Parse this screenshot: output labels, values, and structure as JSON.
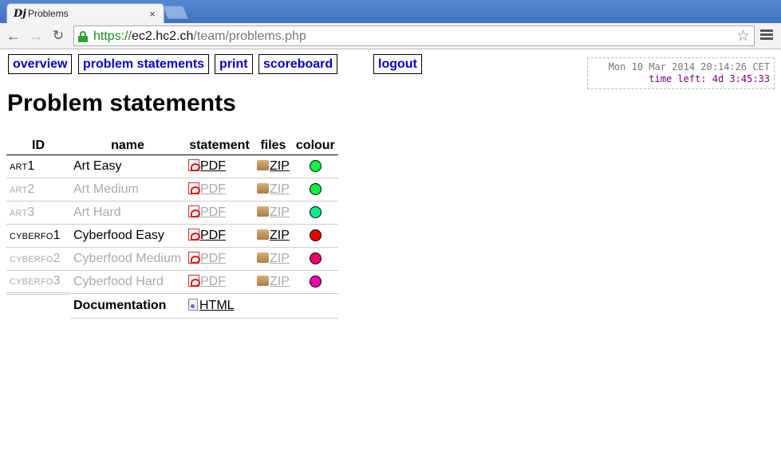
{
  "browser": {
    "tab_title": "Problems",
    "tab_favicon": "Dj",
    "tab_close": "×",
    "url_scheme": "https://",
    "url_host": "ec2.hc2.ch",
    "url_path": "/team/problems.php",
    "back_glyph": "←",
    "forward_glyph": "→",
    "reload_glyph": "↻",
    "star_glyph": "☆"
  },
  "nav": {
    "overview": "overview",
    "problem_statements": "problem statements",
    "print": "print",
    "scoreboard": "scoreboard",
    "logout": "logout"
  },
  "clock": {
    "date": "Mon 10 Mar 2014 20:14:26 CET",
    "time_left": "time left: 4d 3:45:33"
  },
  "page_title": "Problem statements",
  "table": {
    "headers": {
      "id": "ID",
      "name": "name",
      "statement": "statement",
      "files": "files",
      "colour": "colour"
    },
    "rows": [
      {
        "short": "art",
        "num": "1",
        "name": "Art Easy",
        "statement": "PDF",
        "files": "ZIP",
        "colour": "#00ff44",
        "active": true
      },
      {
        "short": "art",
        "num": "2",
        "name": "Art Medium",
        "statement": "PDF",
        "files": "ZIP",
        "colour": "#11ee44",
        "active": false
      },
      {
        "short": "art",
        "num": "3",
        "name": "Art Hard",
        "statement": "PDF",
        "files": "ZIP",
        "colour": "#00ee88",
        "active": false
      },
      {
        "short": "cyberfo",
        "num": "1",
        "name": "Cyberfood Easy",
        "statement": "PDF",
        "files": "ZIP",
        "colour": "#ee0000",
        "active": true
      },
      {
        "short": "cyberfo",
        "num": "2",
        "name": "Cyberfood Medium",
        "statement": "PDF",
        "files": "ZIP",
        "colour": "#ee0066",
        "active": false
      },
      {
        "short": "cyberfo",
        "num": "3",
        "name": "Cyberfood Hard",
        "statement": "PDF",
        "files": "ZIP",
        "colour": "#ee00aa",
        "active": false
      }
    ],
    "documentation": {
      "name": "Documentation",
      "link": "HTML"
    }
  }
}
